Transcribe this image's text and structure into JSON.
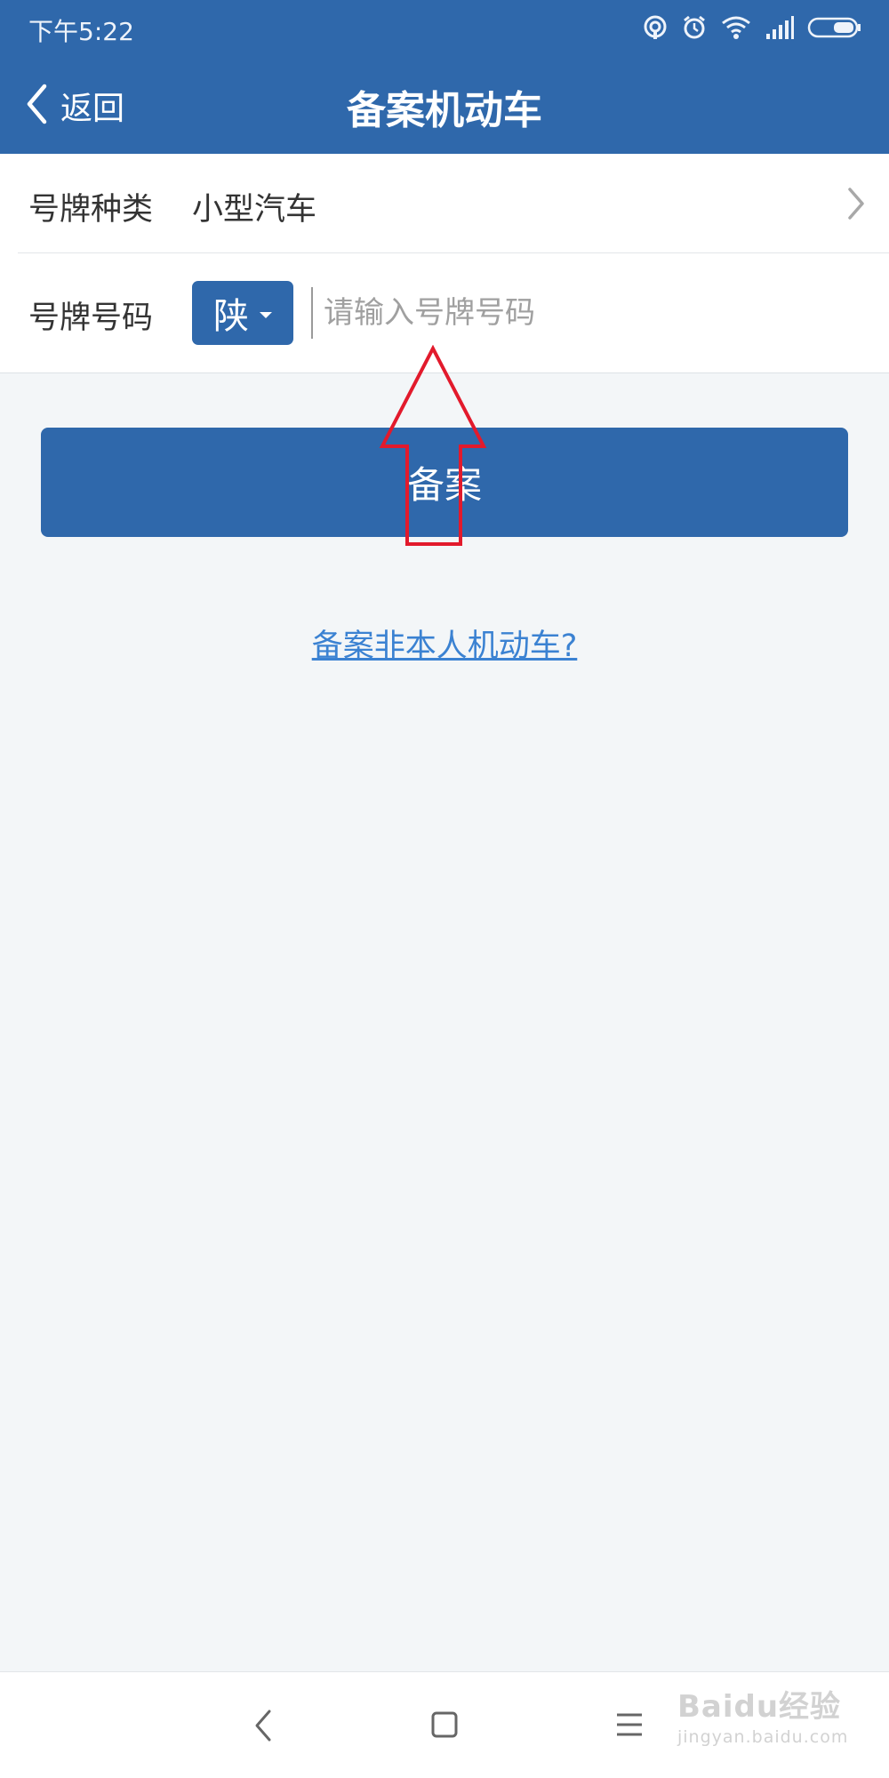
{
  "status_bar": {
    "time": "下午5:22",
    "icons": [
      "hotspot-icon",
      "alarm-icon",
      "wifi-icon",
      "signal-icon",
      "battery-icon"
    ]
  },
  "header": {
    "back_label": "返回",
    "title": "备案机动车"
  },
  "form": {
    "plate_type": {
      "label": "号牌种类",
      "value": "小型汽车"
    },
    "plate_number": {
      "label": "号牌号码",
      "province": "陕",
      "placeholder": "请输入号牌号码",
      "value": ""
    }
  },
  "submit_label": "备案",
  "other_link": "备案非本人机动车?",
  "watermark": {
    "main": "Baidu经验",
    "sub": "jingyan.baidu.com"
  },
  "colors": {
    "primary": "#2f68ab",
    "link": "#3b82d2",
    "annotation_arrow": "#e21a2c",
    "background": "#f3f6f8"
  }
}
